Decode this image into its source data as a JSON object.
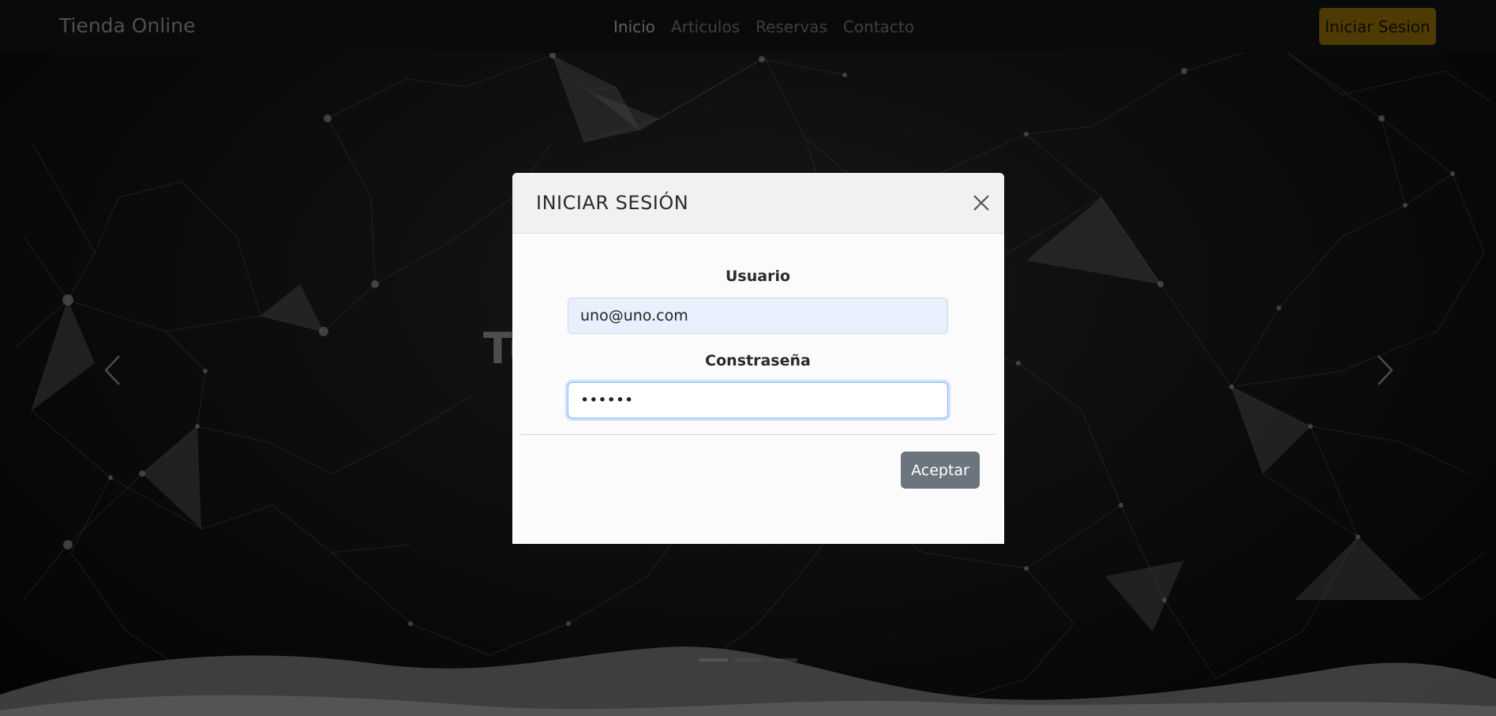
{
  "navbar": {
    "brand": "Tienda Online",
    "links": [
      {
        "label": "Inicio",
        "active": true
      },
      {
        "label": "Articulos",
        "active": false
      },
      {
        "label": "Reservas",
        "active": false
      },
      {
        "label": "Contacto",
        "active": false
      }
    ],
    "login_button": "Iniciar Sesion"
  },
  "hero": {
    "title": "Tu",
    "prev_icon": "chevron-left-icon",
    "next_icon": "chevron-right-icon",
    "indicator_count": 3,
    "active_indicator": 1
  },
  "modal": {
    "title": "INICIAR SESIÓN",
    "close_icon": "close-icon",
    "user_label": "Usuario",
    "user_value": "uno@uno.com",
    "password_label": "Constraseña",
    "password_value": "••••••",
    "accept_button": "Aceptar"
  },
  "colors": {
    "navbar_bg": "#121315",
    "login_button_bg": "#8e6b06",
    "accept_button_bg": "#6c757d",
    "user_input_bg": "#e8f0fe",
    "focus_border": "#86b7fe"
  }
}
